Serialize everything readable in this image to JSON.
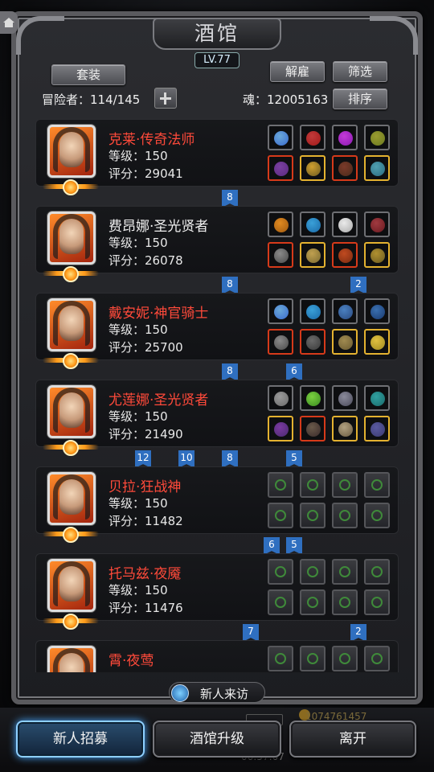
{
  "header": {
    "title": "酒馆",
    "level": "LV.77",
    "outfit_label": "套装",
    "dismiss_label": "解雇",
    "filter_label": "筛选",
    "sort_label": "排序",
    "adventurers_label": "冒险者：114/145",
    "soul_label": "魂：12005163"
  },
  "heroes": [
    {
      "name": "克莱·传奇法师",
      "name_color": "red",
      "level": "等级：150",
      "score": "评分：29041",
      "slots": [
        [
          "#6aa8d8",
          "gem",
          "#3a6bd0"
        ],
        [
          "#c23a3a",
          "gem",
          "#a01a1a"
        ],
        [
          "#c43ad8",
          "gem",
          "#8a1ab0"
        ],
        [
          "#9a9a30",
          "gem",
          "#6a7a20"
        ],
        [
          "#7a40a0",
          "red",
          "#5a2a80"
        ],
        [
          "#d0a030",
          "gold",
          "#6a5a20"
        ],
        [
          "#7a3a2a",
          "red",
          "#4a2a1a"
        ],
        [
          "#50a0b0",
          "gold",
          "#2a6a80"
        ]
      ],
      "links": [
        {
          "text": "8",
          "col": 1
        }
      ]
    },
    {
      "name": "费昂娜·圣光贤者",
      "name_color": "white",
      "level": "等级：150",
      "score": "评分：26078",
      "slots": [
        [
          "#e08a20",
          "gem",
          "#a05a10"
        ],
        [
          "#3aa0d8",
          "gem",
          "#1a6aa8"
        ],
        [
          "#eaeaea",
          "gem",
          "#aaaaaa"
        ],
        [
          "#a03a40",
          "gem",
          "#6a1a20"
        ],
        [
          "#8a8a8a",
          "red",
          "#4a4a4a"
        ],
        [
          "#c0a050",
          "gold",
          "#7a6a30"
        ],
        [
          "#c04a20",
          "red",
          "#7a2a10"
        ],
        [
          "#b09030",
          "gold",
          "#6a5a20"
        ]
      ],
      "links": [
        {
          "text": "8",
          "col": 1
        },
        {
          "text": "2",
          "col": 3
        }
      ]
    },
    {
      "name": "戴安妮·神官骑士",
      "name_color": "red",
      "level": "等级：150",
      "score": "评分：25700",
      "slots": [
        [
          "#6aa8d8",
          "gem",
          "#3a6bd0"
        ],
        [
          "#3aa0d8",
          "gem",
          "#1a6aa8"
        ],
        [
          "#4a80c0",
          "gem",
          "#2a4a80"
        ],
        [
          "#3a70b0",
          "gem",
          "#1a3a70"
        ],
        [
          "#8a8a8a",
          "red",
          "#4a4a4a"
        ],
        [
          "#6a6a6a",
          "red",
          "#3a3a3a"
        ],
        [
          "#a08a50",
          "gold",
          "#6a5a30"
        ],
        [
          "#e0c040",
          "gold",
          "#a08a20"
        ]
      ],
      "links": [
        {
          "text": "8",
          "col": 1
        },
        {
          "text": "6",
          "col": 2
        }
      ]
    },
    {
      "name": "尤莲娜·圣光贤者",
      "name_color": "red",
      "level": "等级：150",
      "score": "评分：21490",
      "slots": [
        [
          "#9a9a9a",
          "gem",
          "#6a6a6a"
        ],
        [
          "#7ad040",
          "gem",
          "#3a8a20"
        ],
        [
          "#8a8a9a",
          "gem",
          "#4a4a5a"
        ],
        [
          "#30a0a0",
          "gem",
          "#1a6a6a"
        ],
        [
          "#7a3aa0",
          "gold",
          "#4a2a70"
        ],
        [
          "#6a5a4a",
          "red",
          "#3a2a2a"
        ],
        [
          "#b0a080",
          "gold",
          "#6a5a40"
        ],
        [
          "#5a5aa0",
          "gold",
          "#3a3a70"
        ]
      ],
      "links": [
        {
          "text": "12",
          "col": -1
        },
        {
          "text": "10",
          "col": 0
        },
        {
          "text": "8",
          "col": 1
        },
        {
          "text": "5",
          "col": 2
        }
      ]
    },
    {
      "name": "贝拉·狂战神",
      "name_color": "red",
      "level": "等级：150",
      "score": "评分：11482",
      "slots": [
        [
          "e",
          "empty",
          ""
        ],
        [
          "e",
          "empty",
          ""
        ],
        [
          "e",
          "empty",
          ""
        ],
        [
          "e",
          "empty",
          ""
        ],
        [
          "e",
          "empty",
          ""
        ],
        [
          "e",
          "empty",
          ""
        ],
        [
          "e",
          "empty",
          ""
        ],
        [
          "e",
          "empty",
          ""
        ]
      ],
      "links": [
        {
          "text": "6",
          "col": 1.6
        },
        {
          "text": "5",
          "col": 2
        }
      ]
    },
    {
      "name": "托马兹·夜魇",
      "name_color": "red",
      "level": "等级：150",
      "score": "评分：11476",
      "slots": [
        [
          "e",
          "empty",
          ""
        ],
        [
          "e",
          "empty",
          ""
        ],
        [
          "e",
          "empty",
          ""
        ],
        [
          "e",
          "empty",
          ""
        ],
        [
          "e",
          "empty",
          ""
        ],
        [
          "e",
          "empty",
          ""
        ],
        [
          "e",
          "empty",
          ""
        ],
        [
          "e",
          "empty",
          ""
        ]
      ],
      "links": [
        {
          "text": "7",
          "col": 1.3
        },
        {
          "text": "2",
          "col": 3
        }
      ]
    },
    {
      "name": "霄·夜莺",
      "name_color": "red",
      "level": "",
      "score": "",
      "slots": [
        [
          "e",
          "empty",
          ""
        ],
        [
          "e",
          "empty",
          ""
        ],
        [
          "e",
          "empty",
          ""
        ],
        [
          "e",
          "empty",
          ""
        ]
      ],
      "links": []
    }
  ],
  "visit_label": "新人来访",
  "footer": {
    "recruit_label": "新人招募",
    "upgrade_label": "酒馆升级",
    "leave_label": "离开",
    "underlay_gold": "1074761457",
    "underlay_time": "06:57:07"
  },
  "colors": {
    "name_red": "#ff4a3a",
    "link_blue": "#2f6fc0",
    "accent_glow": "#4aa8ff"
  }
}
